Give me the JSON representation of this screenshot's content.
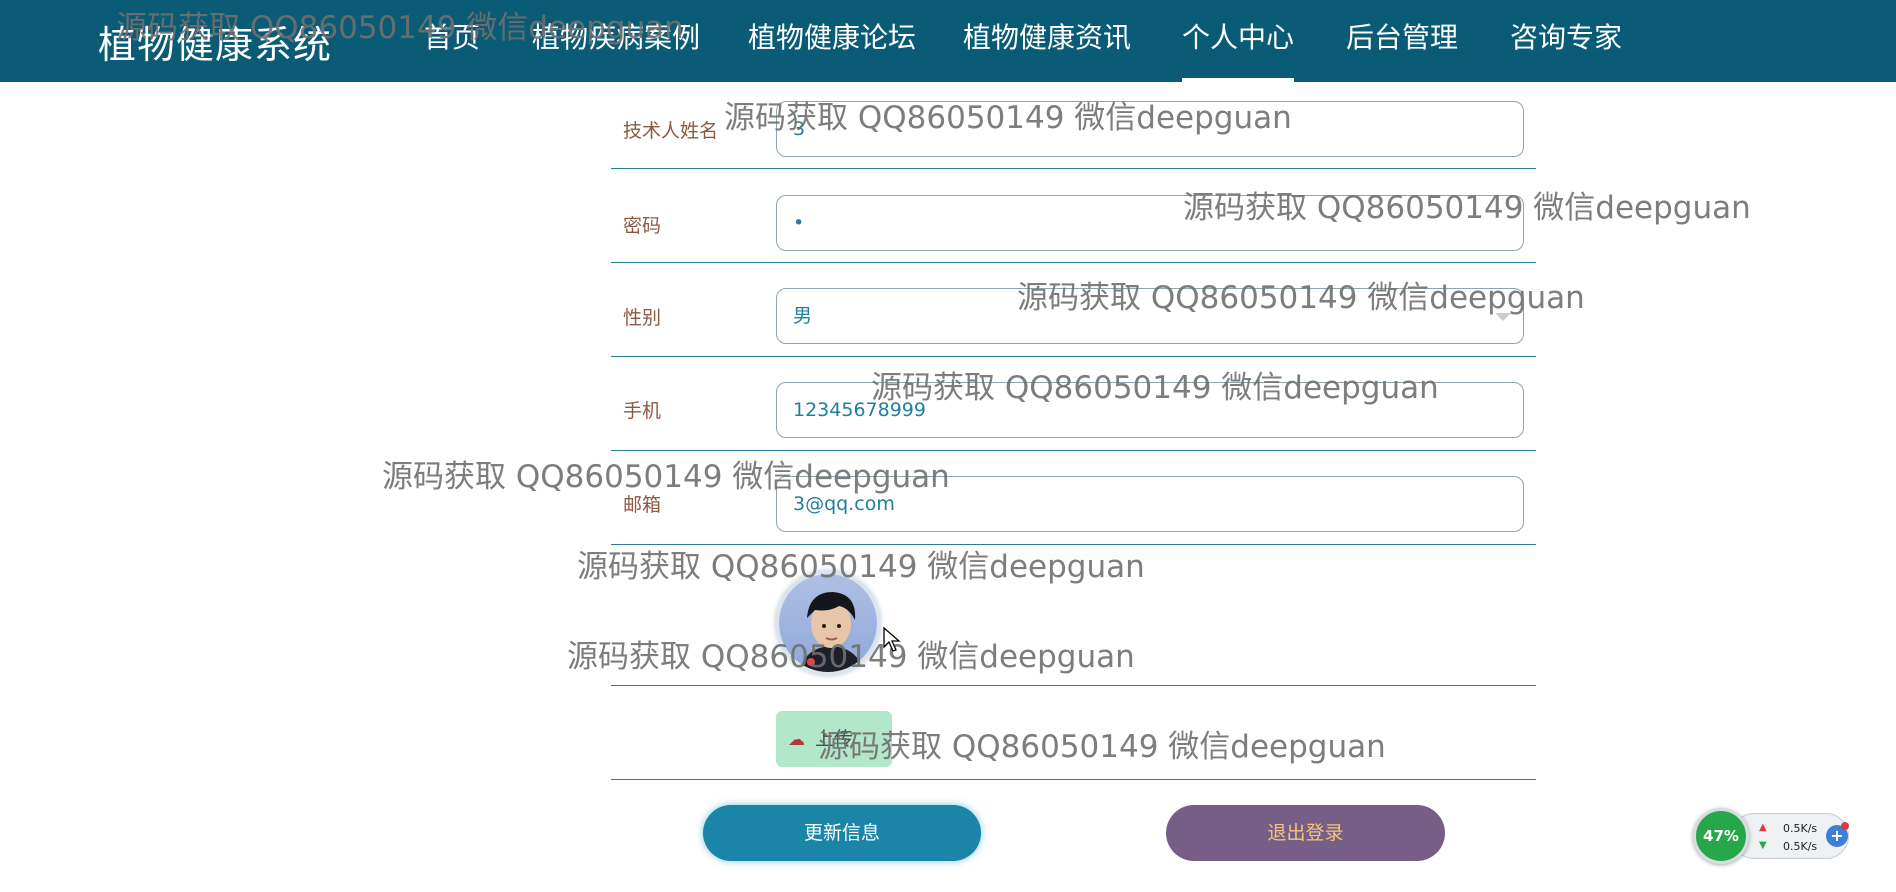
{
  "header": {
    "brand": "植物健康系统",
    "nav": [
      {
        "label": "首页",
        "active": false
      },
      {
        "label": "植物疾病案例",
        "active": false
      },
      {
        "label": "植物健康论坛",
        "active": false
      },
      {
        "label": "植物健康资讯",
        "active": false
      },
      {
        "label": "个人中心",
        "active": true
      },
      {
        "label": "后台管理",
        "active": false
      },
      {
        "label": "咨询专家",
        "active": false
      }
    ]
  },
  "form": {
    "name": {
      "label": "技术人姓名",
      "value": "3"
    },
    "password": {
      "label": "密码",
      "value": "•"
    },
    "gender": {
      "label": "性别",
      "value": "男"
    },
    "phone": {
      "label": "手机",
      "value": "12345678999"
    },
    "email": {
      "label": "邮箱",
      "value": "3@qq.com"
    },
    "avatar": {
      "icon": "user-avatar-photo"
    },
    "upload": {
      "label": "上传",
      "icon": "cloud-upload-icon"
    }
  },
  "actions": {
    "update_label": "更新信息",
    "logout_label": "退出登录"
  },
  "watermark": {
    "text": "源码获取 QQ86050149 微信deepguan"
  },
  "net_widget": {
    "percent": "47%",
    "upload_speed": "0.5K/s",
    "download_speed": "0.5K/s"
  },
  "colors": {
    "header_bg": "#0a5c76",
    "label_color": "#8c5a43",
    "value_color": "#1f7f9c",
    "update_button": "#1b85a7",
    "logout_button": "#765e87",
    "logout_text": "#f4c47a",
    "upload_button": "#b3e7cc"
  }
}
